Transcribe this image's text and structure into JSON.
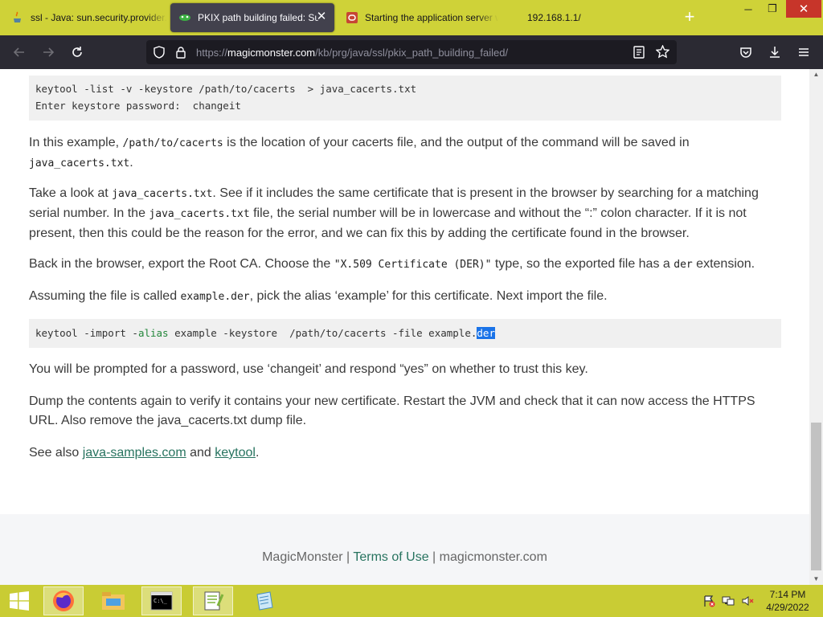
{
  "browser": {
    "tabs": [
      {
        "title": "ssl - Java: sun.security.provider.c"
      },
      {
        "title": "PKIX path building failed: Sun"
      },
      {
        "title": "Starting the application server w"
      },
      {
        "title": "192.168.1.1/"
      }
    ],
    "url_prefix": "https://",
    "url_host": "magicmonster.com",
    "url_path": "/kb/prg/java/ssl/pkix_path_building_failed/"
  },
  "content": {
    "code1_line1": "keytool -list -v -keystore /path/to/cacerts  > java_cacerts.txt",
    "code1_line2": "Enter keystore password:  changeit",
    "p1_a": "In this example, ",
    "p1_code1": "/path/to/cacerts",
    "p1_b": " is the location of your cacerts file, and the output of the command will be saved in ",
    "p1_code2": "java_cacerts.txt",
    "p1_c": ".",
    "p2_a": "Take a look at ",
    "p2_code1": "java_cacerts.txt",
    "p2_b": ". See if it includes the same certificate that is present in the browser by searching for a matching serial number. In the ",
    "p2_code2": "java_cacerts.txt",
    "p2_c": " file, the serial number will be in lowercase and without the “:” colon character. If it is not present, then this could be the reason for the error, and we can fix this by adding the certificate found in the browser.",
    "p3_a": "Back in the browser, export the Root CA. Choose the ",
    "p3_code": "\"X.509 Certificate (DER)\"",
    "p3_b": " type, so the exported file has a ",
    "p3_code2": "der",
    "p3_c": " extension.",
    "p4_a": "Assuming the file is called ",
    "p4_code": "example.der",
    "p4_b": ", pick the alias ‘example’ for this certificate. Next import the file.",
    "code2_a": "keytool -import -",
    "code2_kw": "alias",
    "code2_b": " example -keystore  /path/to/cacerts -file example.",
    "code2_sel": "der",
    "p5": "You will be prompted for a password, use ‘changeit’ and respond “yes” on whether to trust this key.",
    "p6": "Dump the contents again to verify it contains your new certificate. Restart the JVM and check that it can now access the HTTPS URL. Also remove the java_cacerts.txt dump file.",
    "p7_a": "See also ",
    "p7_link1": "java-samples.com",
    "p7_b": " and ",
    "p7_link2": "keytool",
    "p7_c": "."
  },
  "footer": {
    "brand": "MagicMonster",
    "sep1": " | ",
    "terms": "Terms of Use",
    "sep2": " | ",
    "site": "magicmonster.com"
  },
  "taskbar": {
    "time": "7:14 PM",
    "date": "4/29/2022"
  }
}
